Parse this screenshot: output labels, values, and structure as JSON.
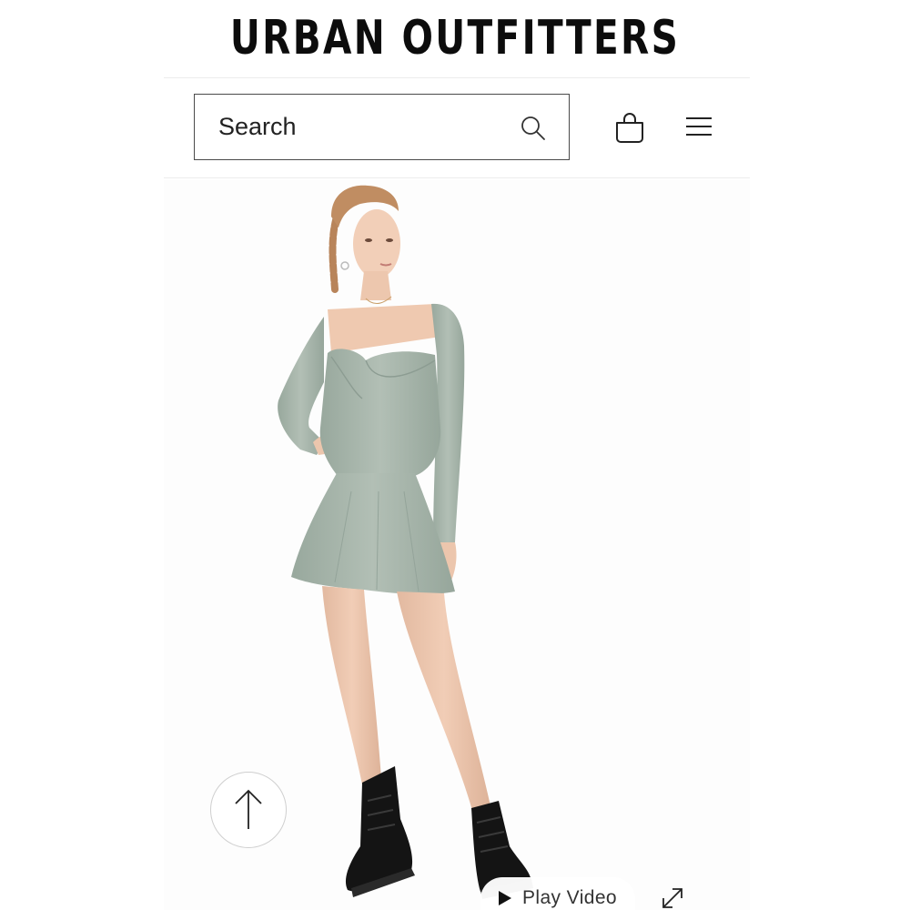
{
  "header": {
    "brand_name": "URBAN OUTFITTERS"
  },
  "search": {
    "placeholder": "Search",
    "icon": "search-icon"
  },
  "actions": {
    "bag_icon": "shopping-bag-icon",
    "menu_icon": "hamburger-menu-icon"
  },
  "product_media": {
    "description_icon": "product-photo",
    "play_video_label": "Play Video",
    "play_icon": "play-icon",
    "expand_icon": "expand-icon",
    "back_to_top_icon": "arrow-up-icon"
  },
  "colors": {
    "dress": "#a3b2a8",
    "skin": "#ecc6ad",
    "hair": "#c08d62",
    "boots": "#141414",
    "border": "#4a4a4a"
  }
}
